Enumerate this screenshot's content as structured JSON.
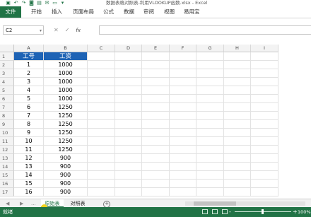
{
  "window": {
    "title": "数据表格对照表-利用VLOOKUP函数.xlsx - Excel"
  },
  "quick_access": [
    "save-icon",
    "undo-icon",
    "redo-icon",
    "camera-icon",
    "print-icon",
    "email-icon",
    "open-icon",
    "more-icon"
  ],
  "ribbon": {
    "tabs": [
      "文件",
      "开始",
      "插入",
      "页面布局",
      "公式",
      "数据",
      "审阅",
      "视图",
      "易用宝"
    ]
  },
  "formula_bar": {
    "name_box": "C2",
    "cancel_icon": "✕",
    "confirm_icon": "✓",
    "fx_label": "fx",
    "value": ""
  },
  "columns": [
    "A",
    "B",
    "C",
    "D",
    "E",
    "F",
    "G",
    "H",
    "I"
  ],
  "table": {
    "headers": [
      "工号",
      "工资"
    ],
    "rows": [
      [
        "1",
        "1000"
      ],
      [
        "2",
        "1000"
      ],
      [
        "3",
        "1000"
      ],
      [
        "4",
        "1000"
      ],
      [
        "5",
        "1000"
      ],
      [
        "6",
        "1250"
      ],
      [
        "7",
        "1250"
      ],
      [
        "8",
        "1250"
      ],
      [
        "9",
        "1250"
      ],
      [
        "10",
        "1250"
      ],
      [
        "11",
        "1250"
      ],
      [
        "12",
        "900"
      ],
      [
        "13",
        "900"
      ],
      [
        "14",
        "900"
      ],
      [
        "15",
        "900"
      ],
      [
        "16",
        "900"
      ]
    ]
  },
  "row_numbers": [
    "1",
    "2",
    "3",
    "4",
    "5",
    "6",
    "7",
    "8",
    "9",
    "10",
    "11",
    "12",
    "13",
    "14",
    "15",
    "16",
    "17"
  ],
  "sheets": {
    "nav_prev": "◀",
    "nav_next": "▶",
    "ellipsis": "...",
    "tabs": [
      "原始表",
      "对照表"
    ],
    "active": 0,
    "add_label": "+"
  },
  "status_bar": {
    "ready": "就绪",
    "zoom_minus": "-",
    "zoom_plus": "+",
    "zoom_value": "100%"
  },
  "colors": {
    "excel_green": "#217346",
    "header_fill": "#1e63b5"
  }
}
